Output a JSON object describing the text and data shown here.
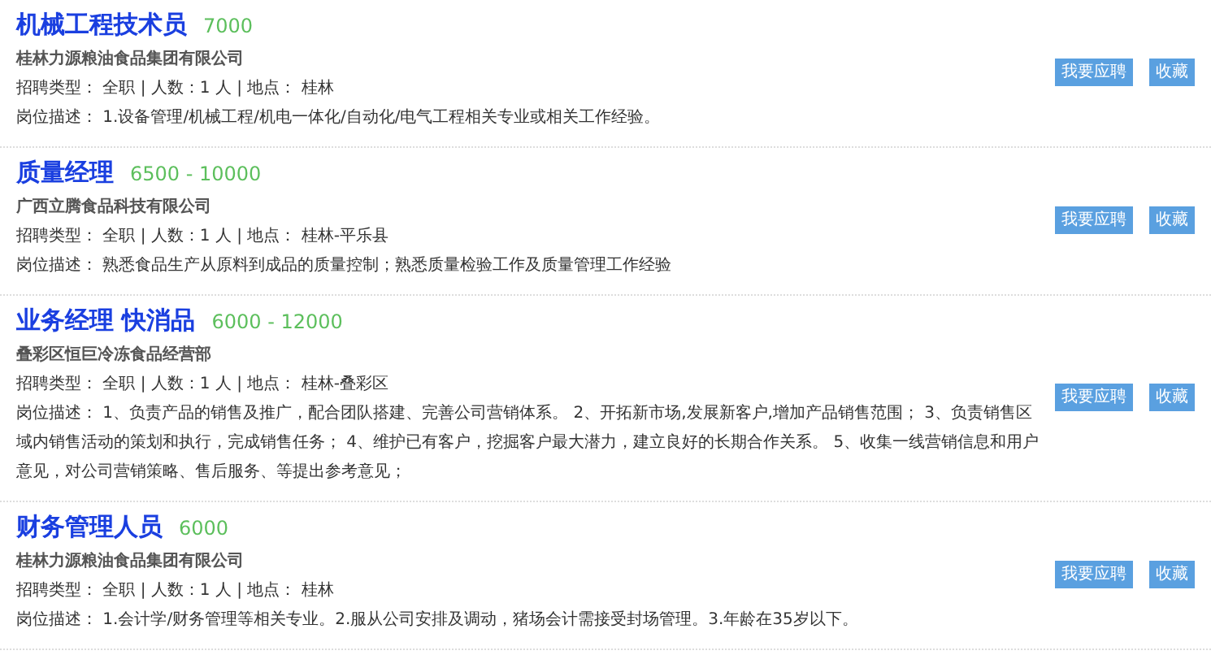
{
  "jobs": [
    {
      "title": "机械工程技术员",
      "salary": "7000",
      "company": "桂林力源粮油食品集团有限公司",
      "info": "招聘类型： 全职 | 人数：1 人 | 地点： 桂林",
      "description": "岗位描述： 1.设备管理/机械工程/机电一体化/自动化/电气工程相关专业或相关工作经验。",
      "buttons": [
        "我要应聘",
        "收藏"
      ]
    },
    {
      "title": "质量经理",
      "salary": "6500 - 10000",
      "company": "广西立腾食品科技有限公司",
      "info": "招聘类型： 全职 | 人数：1 人 | 地点： 桂林-平乐县",
      "description": "岗位描述： 熟悉食品生产从原料到成品的质量控制；熟悉质量检验工作及质量管理工作经验",
      "buttons": [
        "我要应聘",
        "收藏"
      ]
    },
    {
      "title": "业务经理 快消品",
      "salary": "6000 - 12000",
      "company": "叠彩区恒巨冷冻食品经营部",
      "info": "招聘类型： 全职 | 人数：1 人 | 地点： 桂林-叠彩区",
      "description": "岗位描述： 1、负责产品的销售及推广，配合团队搭建、完善公司营销体系。 2、开拓新市场,发展新客户,增加产品销售范围； 3、负责销售区域内销售活动的策划和执行，完成销售任务； 4、维护已有客户，挖掘客户最大潜力，建立良好的长期合作关系。 5、收集一线营销信息和用户意见，对公司营销策略、售后服务、等提出参考意见；",
      "buttons": [
        "我要应聘",
        "收藏"
      ]
    },
    {
      "title": "财务管理人员",
      "salary": "6000",
      "company": "桂林力源粮油食品集团有限公司",
      "info": "招聘类型： 全职 | 人数：1 人 | 地点： 桂林",
      "description": "岗位描述： 1.会计学/财务管理等相关专业。2.服从公司安排及调动，猪场会计需接受封场管理。3.年龄在35岁以下。",
      "buttons": [
        "我要应聘",
        "收藏"
      ]
    }
  ]
}
